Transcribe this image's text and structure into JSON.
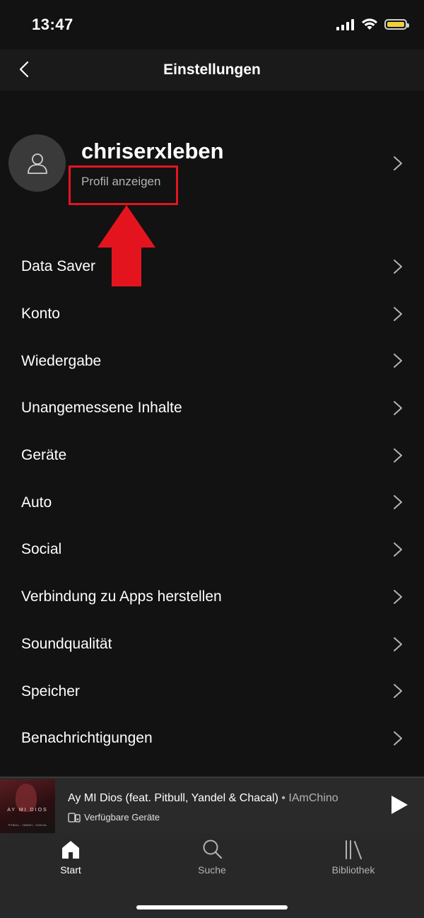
{
  "status_bar": {
    "time": "13:47"
  },
  "header": {
    "title": "Einstellungen"
  },
  "profile": {
    "username": "chriserxleben",
    "link_label": "Profil anzeigen"
  },
  "menu": {
    "items": [
      {
        "label": "Data Saver"
      },
      {
        "label": "Konto"
      },
      {
        "label": "Wiedergabe"
      },
      {
        "label": "Unangemessene Inhalte"
      },
      {
        "label": "Geräte"
      },
      {
        "label": "Auto"
      },
      {
        "label": "Social"
      },
      {
        "label": "Verbindung zu Apps herstellen"
      },
      {
        "label": "Soundqualität"
      },
      {
        "label": "Speicher"
      },
      {
        "label": "Benachrichtigungen"
      }
    ]
  },
  "now_playing": {
    "title": "Ay MI Dios (feat. Pitbull, Yandel & Chacal)",
    "separator": " • ",
    "artist": "IAmChino",
    "device_label": "Verfügbare Geräte",
    "cover_text": "AY MI DIOS",
    "cover_subtext": "PITBULL · YANDEL · CHACAL"
  },
  "tabs": [
    {
      "label": "Start",
      "icon": "home-icon",
      "active": true
    },
    {
      "label": "Suche",
      "icon": "search-icon",
      "active": false
    },
    {
      "label": "Bibliothek",
      "icon": "library-icon",
      "active": false
    }
  ],
  "colors": {
    "background": "#121212",
    "highlight": "#e4141f",
    "annotation_arrow": "#e4141f",
    "battery": "#f4cf3a"
  }
}
